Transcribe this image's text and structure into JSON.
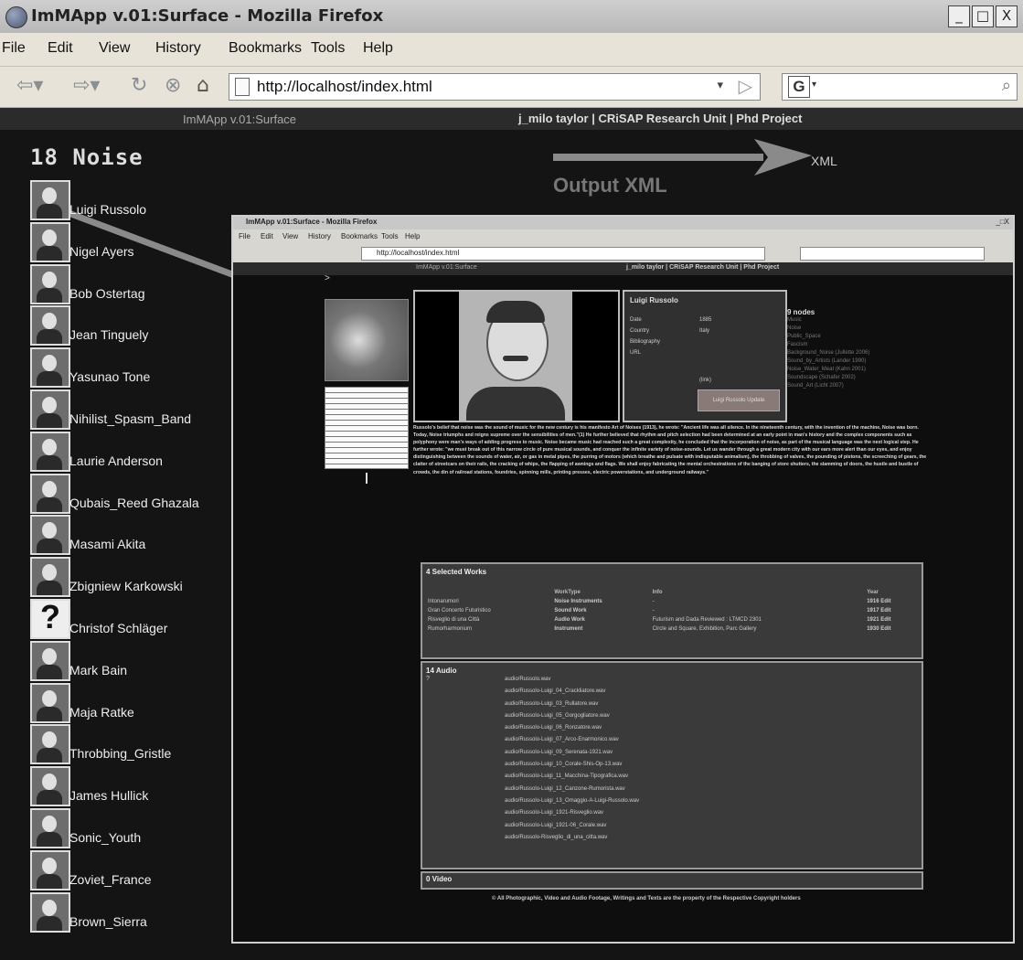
{
  "window": {
    "title": "ImMApp v.01:Surface - Mozilla Firefox",
    "buttons": {
      "minimize": "_",
      "maximize": "□",
      "close": "X"
    }
  },
  "menu": [
    "File",
    "Edit",
    "View",
    "History",
    "Bookmarks",
    "Tools",
    "Help"
  ],
  "nav": {
    "url": "http://localhost/index.html",
    "search_engine": "G"
  },
  "page": {
    "header_left": "ImMApp v.01:Surface",
    "header_right": "j_milo taylor | CRiSAP Research Unit | Phd Project",
    "heading": "18 Noise",
    "output_label": "Output XML",
    "xml_link": "XML",
    "artists": [
      {
        "name": "Luigi Russolo"
      },
      {
        "name": "Nigel Ayers"
      },
      {
        "name": "Bob Ostertag"
      },
      {
        "name": "Jean Tinguely"
      },
      {
        "name": "Yasunao Tone"
      },
      {
        "name": "Nihilist_Spasm_Band"
      },
      {
        "name": "Laurie Anderson"
      },
      {
        "name": "Qubais_Reed Ghazala"
      },
      {
        "name": "Masami Akita"
      },
      {
        "name": "Zbigniew Karkowski"
      },
      {
        "name": "Christof Schläger",
        "unknown": true
      },
      {
        "name": "Mark Bain"
      },
      {
        "name": "Maja Ratke"
      },
      {
        "name": "Throbbing_Gristle"
      },
      {
        "name": "James Hullick"
      },
      {
        "name": "Sonic_Youth"
      },
      {
        "name": "Zoviet_France"
      },
      {
        "name": "Brown_Sierra"
      }
    ]
  },
  "inner": {
    "title": "ImMApp v.01:Surface - Mozilla Firefox",
    "close_btns": "_□X",
    "menu": [
      "File",
      "Edit",
      "View",
      "History",
      "Bookmarks",
      "Tools",
      "Help"
    ],
    "url": "http://localhost/index.html",
    "header_left": "ImMApp v.01:Surface",
    "header_right": "j_milo taylor | CRiSAP Research Unit | Phd Project",
    "cursor": ">",
    "artist": {
      "name": "Luigi Russolo",
      "fields": [
        {
          "label": "Date",
          "value": "1885"
        },
        {
          "label": "Country",
          "value": "Italy"
        },
        {
          "label": "Bibliography",
          "value": ""
        },
        {
          "label": "URL",
          "value": ""
        }
      ],
      "link": "(link)",
      "button": "Luigi Russolo Update"
    },
    "nodes": {
      "heading": "9 nodes",
      "items": [
        "Music",
        "Noise",
        "Public_Space",
        "Fascism",
        "Background_Noise (Jullette 2006)",
        "Sound_by_Artists (Lander 1990)",
        "Noise_Water_Meat (Kahn 2001)",
        "Soundscape (Schafer 2002)",
        "Sound_Art (Licht 2007)"
      ]
    },
    "bio": "Russolo's belief that noise was the sound of music for the new century is his manifesto Art of Noises (1913), he wrote: \"Ancient life was all silence. In the nineteenth century, with the invention of the machine, Noise was born. Today, Noise triumphs and reigns supreme over the sensibilities of men.\"(1) He further believed that rhythm and pitch selection had been determined at an early point in man's history and the complex components such as polyphony were man's ways of adding progress to music. Noise became music had reached such a great complexity, he concluded that the incorporation of noise, as part of the musical language was the next logical step. He further wrote: \"we must break out of this narrow circle of pure musical sounds, and conquer the infinite variety of noise-sounds. Let us wander through a great modern city with our ears more alert than our eyes, and enjoy distinguishing between the sounds of water, air, or gas in metal pipes, the purring of motors (which breathe and pulsate with indisputable animalism), the throbbing of valves, the pounding of pistons, the screeching of gears, the clatter of streetcars on their rails, the cracking of whips, the flapping of awnings and flags. We shall enjoy fabricating the mental orchestrations of the banging of store shutters, the slamming of doors, the hustle and bustle of crowds, the din of railroad stations, foundries, spinning mills, printing presses, electric powerstations, and underground railways.\"",
    "works": {
      "heading": "4 Selected Works",
      "columns": [
        "",
        "WorkType",
        "Info",
        "Year"
      ],
      "rows": [
        [
          "Intonarumori",
          "Noise Instruments",
          "-",
          "1916 Edit"
        ],
        [
          "Gran Concerto Futuristico",
          "Sound Work",
          "-",
          "1917 Edit"
        ],
        [
          "Risveglio di una Città",
          "Audio Work",
          "Futurism and Dada Reviewed : LTMCD 2301",
          "1921 Edit"
        ],
        [
          "Rumorharmonium",
          "Instrument",
          "Circle and Square, Exhibition, Parc Gallery",
          "1930 Edit"
        ]
      ]
    },
    "audio": {
      "heading": "14 Audio",
      "marker": "?",
      "files": [
        "audio/Russolo.wav",
        "audio/Russolo-Luigi_04_Crackliatore.wav",
        "audio/Russolo-Luigi_03_Rullatore.wav",
        "audio/Russolo-Luigi_05_Gorgogliatore.wav",
        "audio/Russolo-Luigi_06_Ronzatore.wav",
        "audio/Russolo-Luigi_07_Arco-Enarmonico.wav",
        "audio/Russolo-Luigi_09_Serenata-1921.wav",
        "audio/Russolo-Luigi_10_Corale-Shis-Op-13.wav",
        "audio/Russolo-Luigi_11_Macchina-Tipografica.wav",
        "audio/Russolo-Luigi_12_Canzone-Rumorista.wav",
        "audio/Russolo-Luigi_13_Omaggio-A-Luigi-Russolo.wav",
        "audio/Russolo-Luigi_1921-Risveglio.wav",
        "audio/Russolo-Luigi_1921-06_Corale.wav",
        "audio/Russolo-Risveglio_di_una_citta.wav"
      ]
    },
    "video": {
      "heading": "0 Video"
    },
    "footer": "© All Photographic, Video and Audio Footage, Writings and Texts are the property of the Respective Copyright holders"
  },
  "colors": {
    "page_bg": "#141414",
    "chrome_bg": "#e7e3d9",
    "panel_bg": "#3a3a3a",
    "arrow": "#8a8a8a"
  }
}
